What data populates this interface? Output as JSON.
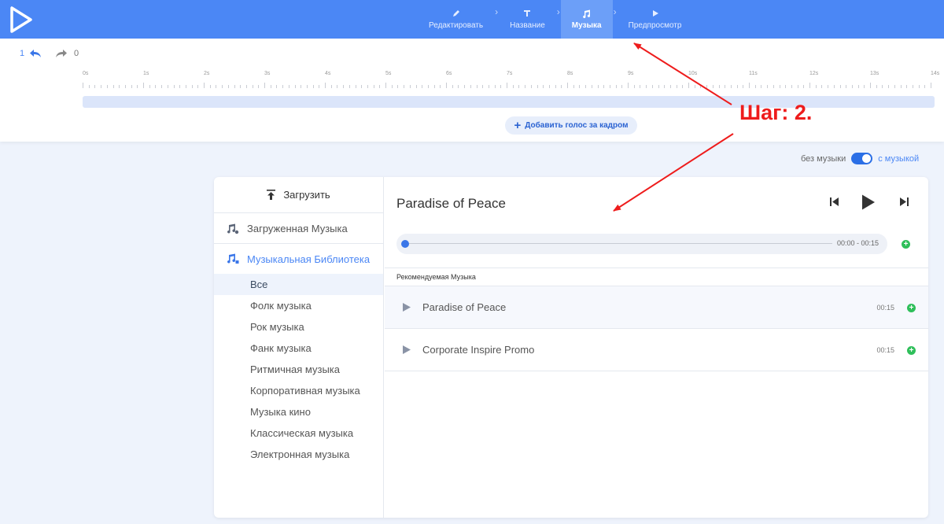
{
  "nav": {
    "steps": [
      {
        "label": "Редактировать",
        "icon": "pencil-icon"
      },
      {
        "label": "Название",
        "icon": "text-icon"
      },
      {
        "label": "Музыка",
        "icon": "music-note-icon",
        "active": true
      },
      {
        "label": "Предпросмотр",
        "icon": "play-icon"
      }
    ]
  },
  "history": {
    "undo_count": "1",
    "redo_count": "0"
  },
  "timeline": {
    "labels": [
      "0s",
      "1s",
      "2s",
      "3s",
      "4s",
      "5s",
      "6s",
      "7s",
      "8s",
      "9s",
      "10s",
      "11s",
      "12s",
      "13s",
      "14s"
    ],
    "add_voice_label": "Добавить голос за кадром"
  },
  "music_toggle": {
    "off_label": "без музыки",
    "on_label": "с музыкой",
    "enabled": true
  },
  "sidebar": {
    "upload_label": "Загрузить",
    "uploaded_label": "Загруженная Музыка",
    "library_label": "Музыкальная Библиотека",
    "categories": [
      "Все",
      "Фолк музыка",
      "Рок музыка",
      "Фанк музыка",
      "Ритмичная музыка",
      "Корпоративная музыка",
      "Музыка кино",
      "Классическая музыка",
      "Электронная музыка"
    ],
    "active_category": "Все"
  },
  "player": {
    "title": "Paradise of Peace",
    "time": "00:00 - 00:15",
    "progress": 0
  },
  "recommended": {
    "header": "Рекомендуемая Музыка",
    "tracks": [
      {
        "name": "Paradise of Peace",
        "duration": "00:15"
      },
      {
        "name": "Corporate Inspire Promo",
        "duration": "00:15"
      }
    ]
  },
  "annotation": {
    "label": "Шаг: 2."
  },
  "colors": {
    "brand": "#4b87f5",
    "annotation": "#ee1c1c",
    "add": "#2fbf5a"
  }
}
